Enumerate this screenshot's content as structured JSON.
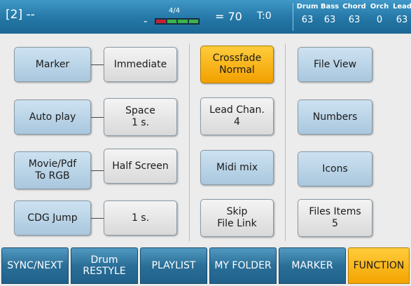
{
  "status": {
    "song": "[2] --",
    "meter_dash": "-",
    "time_signature": "4/4",
    "beats_total": 4,
    "beat_active": 1,
    "tempo": "= 70",
    "transpose": "T:0",
    "tracks": [
      {
        "name": "Drum",
        "value": "63"
      },
      {
        "name": "Bass",
        "value": "63"
      },
      {
        "name": "Chord",
        "value": "63"
      },
      {
        "name": "Orch",
        "value": "0"
      },
      {
        "name": "Lead",
        "value": "63"
      }
    ]
  },
  "buttons": {
    "marker": "Marker",
    "immediate": "Immediate",
    "auto_play": "Auto play",
    "space": "Space\n1 s.",
    "movie_pdf": "Movie/Pdf\nTo RGB",
    "half_screen": "Half Screen",
    "cdg_jump": "CDG Jump",
    "cdg_time": "1 s.",
    "crossfade": "Crossfade\nNormal",
    "lead_chan": "Lead Chan.\n4",
    "midi_mix": "Midi mix",
    "skip_file_link": "Skip\nFile Link",
    "file_view": "File View",
    "numbers": "Numbers",
    "icons": "Icons",
    "files_items": "Files Items\n5"
  },
  "tabs": {
    "sync_next": "SYNC/NEXT",
    "drum_restyle": "Drum\nRESTYLE",
    "playlist": "PLAYLIST",
    "my_folder": "MY FOLDER",
    "marker": "MARKER",
    "function": "FUNCTION"
  },
  "colors": {
    "header_blue": "#2477a6",
    "button_blue": "#a9c7de",
    "active_orange": "#f4a400",
    "beat_red": "#c8202f",
    "beat_green": "#3cb44a"
  }
}
